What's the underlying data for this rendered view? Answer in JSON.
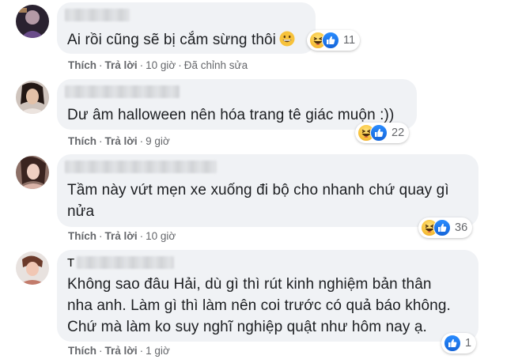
{
  "comments": [
    {
      "name_initial": "",
      "text_lines": [
        "Ai rồi cũng sẽ bị cắm sừng thôi"
      ],
      "inline_emoji": "grinning-face",
      "actions": {
        "like": "Thích",
        "reply": "Trả lời",
        "time": "10 giờ",
        "edited": "Đã chỉnh sửa"
      },
      "reactions": {
        "icons": [
          "haha-icon",
          "like-icon"
        ],
        "count": "11"
      }
    },
    {
      "name_initial": "",
      "text_lines": [
        "Dư âm halloween nên hóa trang tê giác muộn :))"
      ],
      "actions": {
        "like": "Thích",
        "reply": "Trả lời",
        "time": "9 giờ"
      },
      "reactions": {
        "icons": [
          "haha-icon",
          "like-icon"
        ],
        "count": "22"
      }
    },
    {
      "name_initial": "",
      "text_lines": [
        "Tầm này vứt mẹn xe xuống đi bộ cho nhanh chứ quay gì",
        "nửa"
      ],
      "actions": {
        "like": "Thích",
        "reply": "Trả lời",
        "time": "10 giờ"
      },
      "reactions": {
        "icons": [
          "haha-icon",
          "like-icon"
        ],
        "count": "36"
      }
    },
    {
      "name_initial": "T",
      "text_lines": [
        "Không sao đâu Hải, dù gì thì rút kinh nghiệm bản thân",
        "nha anh. Làm gì thì làm nên coi trước có quả báo không.",
        "Chứ mà làm ko suy nghĩ nghiệp quật như hôm nay ạ."
      ],
      "actions": {
        "like": "Thích",
        "reply": "Trả lời",
        "time": "1 giờ"
      },
      "reactions": {
        "icons": [
          "like-icon"
        ],
        "count": "1"
      }
    }
  ],
  "colors": {
    "bubble": "#f0f2f5",
    "text": "#1c1e21",
    "meta": "#65676b",
    "like_blue": "#1877f2",
    "haha_yellow": "#f7c23b"
  }
}
